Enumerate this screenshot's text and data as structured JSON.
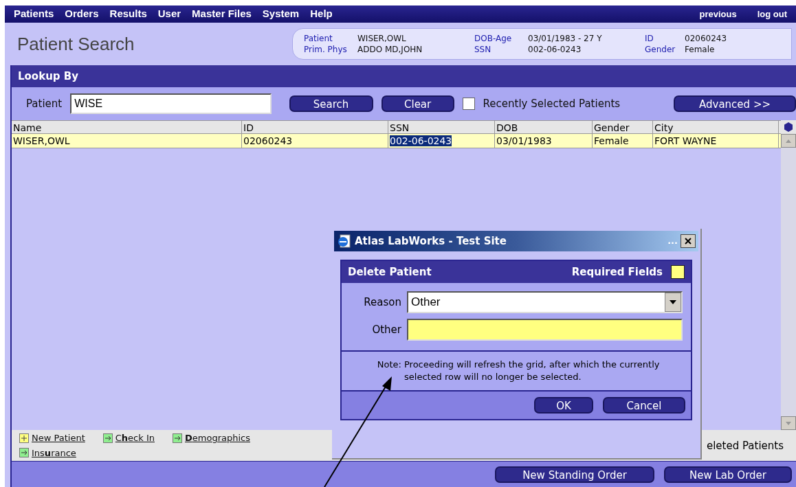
{
  "menu": [
    "Patients",
    "Orders",
    "Results",
    "User",
    "Master Files",
    "System",
    "Help"
  ],
  "nav_links": [
    "previous",
    "log out"
  ],
  "page_title": "Patient Search",
  "patient_info": [
    {
      "label": "Patient",
      "value": "WISER,OWL"
    },
    {
      "label": "Prim. Phys",
      "value": "ADDO MD,JOHN"
    },
    {
      "label": "DOB-Age",
      "value": "03/01/1983 - 27 Y"
    },
    {
      "label": "SSN",
      "value": "002-06-0243"
    },
    {
      "label": "ID",
      "value": "02060243"
    },
    {
      "label": "Gender",
      "value": "Female"
    }
  ],
  "lookup": {
    "title": "Lookup By",
    "field_label": "Patient",
    "field_value": "WISE",
    "search_button": "Search",
    "clear_button": "Clear",
    "recent_label": "Recently Selected Patients",
    "recent_checked": false,
    "advanced_button": "Advanced >>"
  },
  "table": {
    "columns": [
      "Name",
      "ID",
      "SSN",
      "DOB",
      "Gender",
      "City"
    ],
    "rows": [
      {
        "cells": [
          {
            "text": "WISER,OWL",
            "selected": false
          },
          {
            "text": "02060243",
            "selected": false
          },
          {
            "text": "002-06-0243",
            "selected": true
          },
          {
            "text": "03/01/1983",
            "selected": false
          },
          {
            "text": "Female",
            "selected": false
          },
          {
            "text": "FORT WAYNE",
            "selected": false
          }
        ]
      }
    ]
  },
  "footer_links": [
    {
      "kind": "add",
      "label": "New Patient"
    },
    {
      "kind": "go",
      "label": "C**h**eck In"
    },
    {
      "kind": "go",
      "label": "**D**emographics"
    },
    {
      "kind": "go",
      "label": "Ins**u**rance"
    }
  ],
  "footer_right_text": "eleted Patients",
  "bottom_buttons": [
    "New Standing Order",
    "New Lab Order"
  ],
  "dialog": {
    "title": "Atlas LabWorks - Test Site",
    "title_dots": "...",
    "heading": "Delete Patient",
    "required_label": "Required Fields",
    "reason_label": "Reason",
    "reason_value": "Other",
    "other_label": "Other",
    "note_label": "Note:",
    "note_text": "Proceeding will refresh the grid, after which the currently selected row will no longer be selected.",
    "ok_button": "OK",
    "cancel_button": "Cancel"
  }
}
